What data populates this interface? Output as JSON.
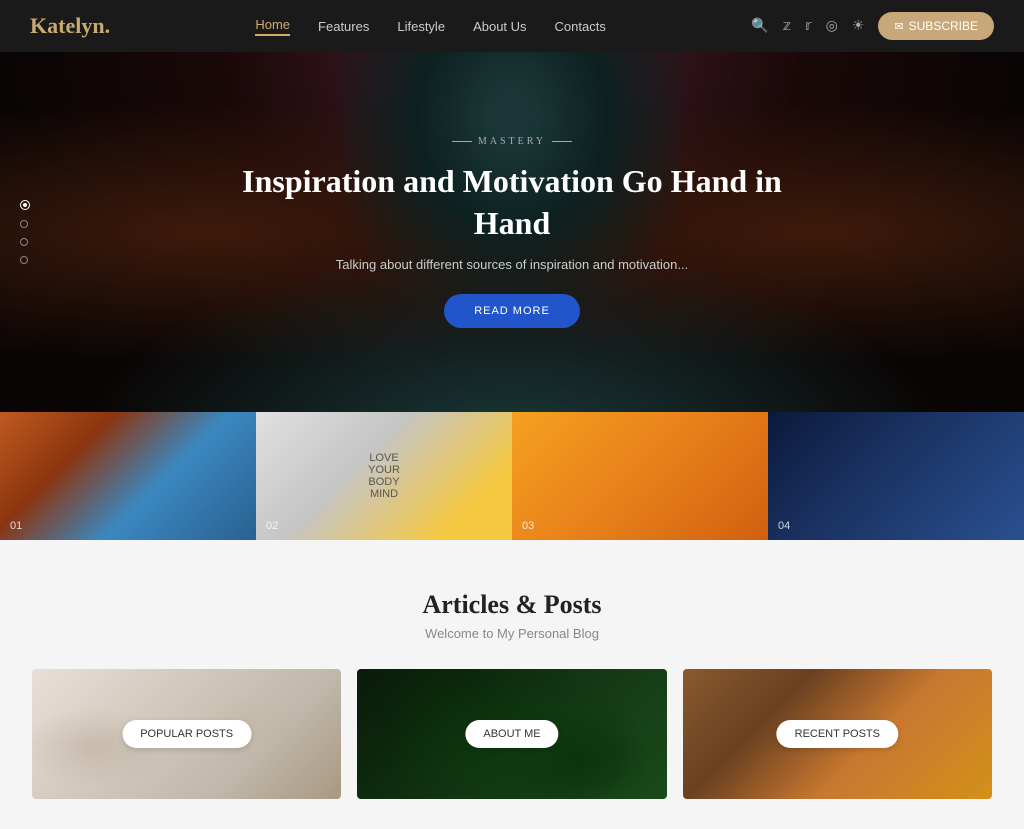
{
  "header": {
    "logo": "Katelyn",
    "logo_dot": ".",
    "nav": [
      {
        "label": "Home",
        "active": true
      },
      {
        "label": "Features",
        "active": false
      },
      {
        "label": "Lifestyle",
        "active": false
      },
      {
        "label": "About Us",
        "active": false
      },
      {
        "label": "Contacts",
        "active": false
      }
    ],
    "subscribe_label": "SUBSCRIBE"
  },
  "hero": {
    "tag": "MASTERY",
    "title": "Inspiration and Motivation Go Hand in Hand",
    "subtitle": "Talking about different sources of inspiration and motivation...",
    "cta_label": "READ MORE"
  },
  "gallery": {
    "items": [
      {
        "num": "01"
      },
      {
        "num": "02"
      },
      {
        "num": "03"
      },
      {
        "num": "04"
      }
    ]
  },
  "articles": {
    "title": "Articles & Posts",
    "subtitle": "Welcome to My Personal Blog",
    "cards": [
      {
        "button_label": "POPULAR POSTS"
      },
      {
        "button_label": "ABOUT ME"
      },
      {
        "button_label": "RECENT POSTS"
      }
    ]
  }
}
